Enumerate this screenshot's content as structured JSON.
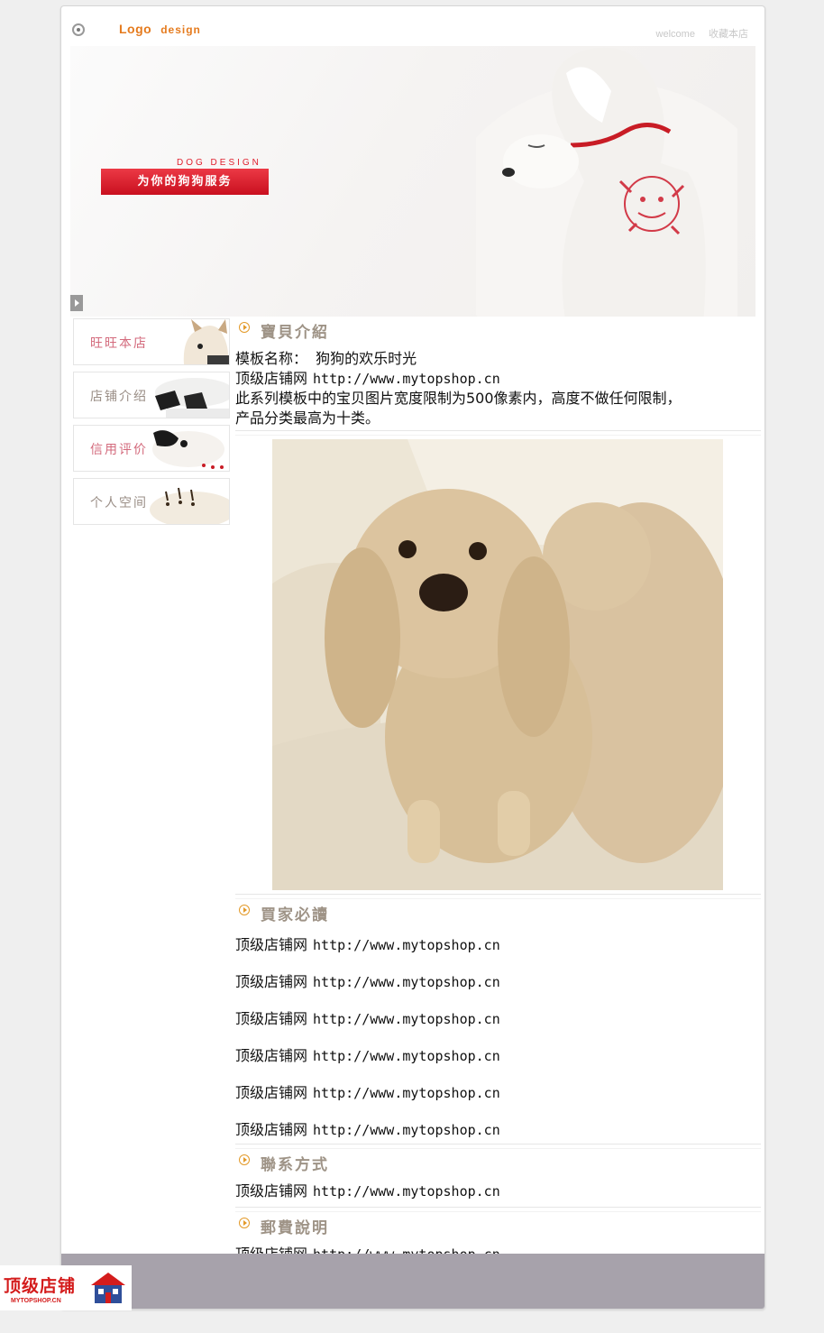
{
  "header": {
    "logo_text": "Logo",
    "logo_sub": "design",
    "links": [
      "welcome",
      "收藏本店"
    ]
  },
  "banner": {
    "small_text": "DOG DESIGN",
    "button_text": "为你的狗狗服务"
  },
  "sidebar": {
    "items": [
      {
        "label": "旺旺本店"
      },
      {
        "label": "店铺介绍"
      },
      {
        "label": "信用评价"
      },
      {
        "label": "个人空间"
      }
    ]
  },
  "sections": {
    "intro": {
      "title": "寶貝介紹",
      "template_label": "模板名称：",
      "template_name": "狗狗的欢乐时光",
      "site_name": "顶级店铺网",
      "site_url": "http://www.mytopshop.cn",
      "desc_line1": "此系列模板中的宝贝图片宽度限制为500像素内，高度不做任何限制，",
      "desc_line2": "产品分类最高为十类。"
    },
    "buyer": {
      "title": "買家必讀",
      "lines": [
        {
          "name": "顶级店铺网",
          "url": "http://www.mytopshop.cn"
        },
        {
          "name": "顶级店铺网",
          "url": "http://www.mytopshop.cn"
        },
        {
          "name": "顶级店铺网",
          "url": "http://www.mytopshop.cn"
        },
        {
          "name": "顶级店铺网",
          "url": "http://www.mytopshop.cn"
        },
        {
          "name": "顶级店铺网",
          "url": "http://www.mytopshop.cn"
        },
        {
          "name": "顶级店铺网",
          "url": "http://www.mytopshop.cn"
        }
      ]
    },
    "contact": {
      "title": "聯系方式",
      "name": "顶级店铺网",
      "url": "http://www.mytopshop.cn"
    },
    "shipping": {
      "title": "郵費說明",
      "name": "顶级店铺网",
      "url": "http://www.mytopshop.cn"
    }
  },
  "badge": {
    "title": "顶级店铺",
    "url": "MYTOPSHOP.CN"
  },
  "colors": {
    "accent": "#e57b1e",
    "banner_red": "#d9192a",
    "footer": "#a7a2ab"
  }
}
